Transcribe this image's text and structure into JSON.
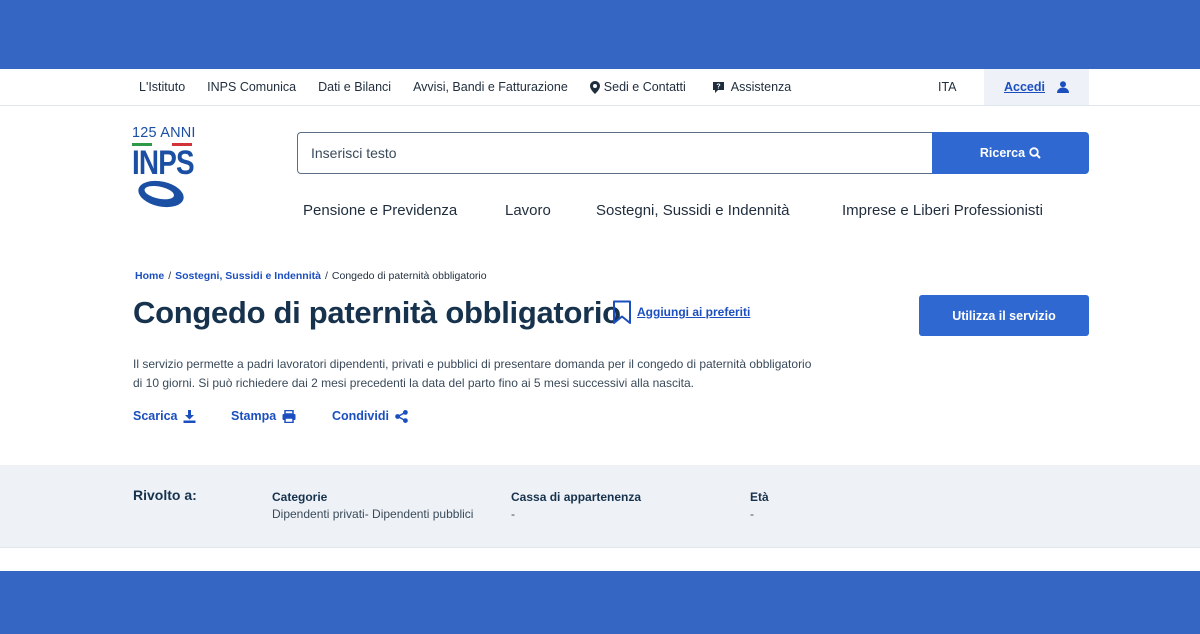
{
  "utility": {
    "links": [
      "L'Istituto",
      "INPS Comunica",
      "Dati e Bilanci",
      "Avvisi, Bandi e Fatturazione",
      "Sedi e Contatti",
      "Assistenza"
    ],
    "lang": "ITA",
    "login": "Accedi"
  },
  "logo": {
    "anni": "125 ANNI",
    "name": "INPS"
  },
  "search": {
    "placeholder": "Inserisci testo",
    "button": "Ricerca"
  },
  "nav": [
    "Pensione e Previdenza",
    "Lavoro",
    "Sostegni, Sussidi e Indennità",
    "Imprese e Liberi Professionisti"
  ],
  "breadcrumb": {
    "home": "Home",
    "section": "Sostegni, Sussidi e Indennità",
    "current": "Congedo di paternità obbligatorio",
    "sep": "/"
  },
  "page": {
    "title": "Congedo di paternità obbligatorio",
    "favorite": "Aggiungi ai preferiti",
    "cta": "Utilizza il servizio",
    "desc1": "Il servizio permette a padri lavoratori dipendenti, privati e pubblici di presentare domanda per il congedo di paternità obbligatorio",
    "desc2": "di 10 giorni. Si può richiedere dai 2 mesi precedenti la data del parto fino ai 5 mesi successivi alla nascita."
  },
  "actions": {
    "download": "Scarica",
    "print": "Stampa",
    "share": "Condividi"
  },
  "audience": {
    "label": "Rivolto a:",
    "columns": [
      {
        "header": "Categorie",
        "value": "Dipendenti privati- Dipendenti pubblici"
      },
      {
        "header": "Cassa di appartenenza",
        "value": "-"
      },
      {
        "header": "Età",
        "value": "-"
      }
    ]
  },
  "colors": {
    "brand": "#3566c3",
    "primary": "#2f68d1",
    "link": "#1b4fbf",
    "text": "#17324d"
  }
}
